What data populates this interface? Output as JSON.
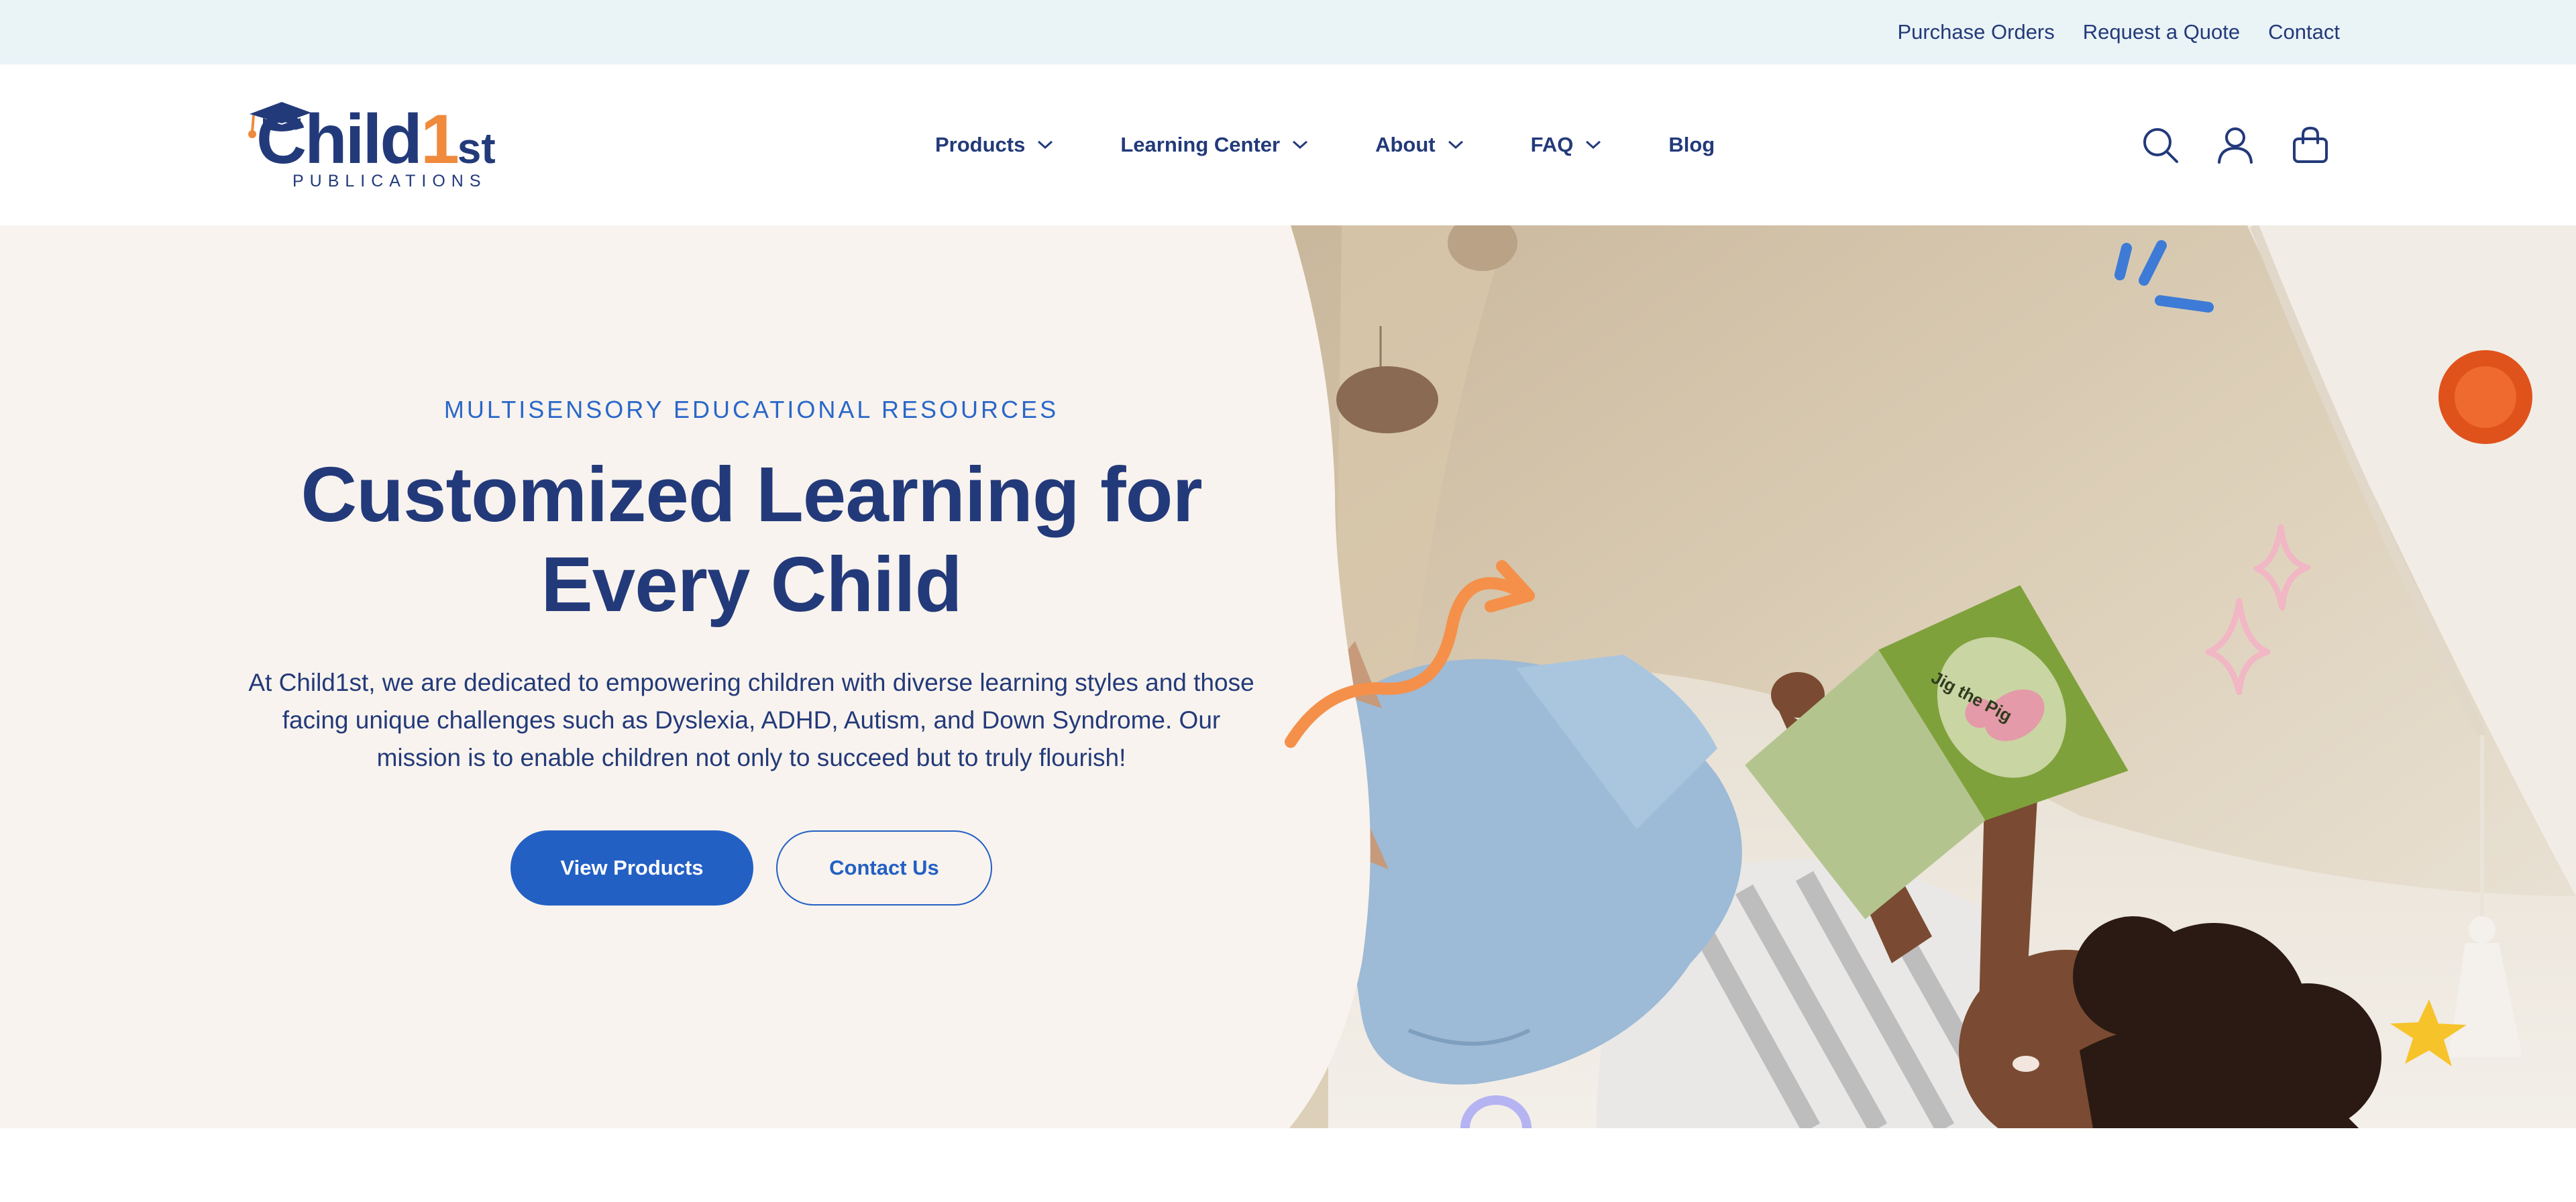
{
  "utility": {
    "links": [
      "Purchase Orders",
      "Request a Quote",
      "Contact"
    ]
  },
  "logo": {
    "name_main": "Child",
    "name_number": "1",
    "name_suffix": "st",
    "sub": "PUBLICATIONS"
  },
  "nav": {
    "items": [
      {
        "label": "Products",
        "dropdown": true
      },
      {
        "label": "Learning Center",
        "dropdown": true
      },
      {
        "label": "About",
        "dropdown": true
      },
      {
        "label": "FAQ",
        "dropdown": true
      },
      {
        "label": "Blog",
        "dropdown": false
      }
    ]
  },
  "header_icons": [
    "search-icon",
    "account-icon",
    "cart-icon"
  ],
  "hero": {
    "eyebrow": "MULTISENSORY EDUCATIONAL RESOURCES",
    "title_line1": "Customized Learning for",
    "title_line2": "Every Child",
    "description": "At Child1st, we are dedicated to empowering children with diverse learning styles and those facing unique challenges such as Dyslexia, ADHD, Autism, and Down Syndrome. Our mission is to enable children not only to succeed but to truly flourish!",
    "primary_button": "View Products",
    "secondary_button": "Contact Us",
    "book_title": "Jig the Pig"
  },
  "colors": {
    "navy": "#233a7a",
    "brand_blue": "#2360c4",
    "orange": "#f08a3c",
    "utility_bg": "#eaf3f6",
    "hero_bg": "#f8f3ee"
  }
}
